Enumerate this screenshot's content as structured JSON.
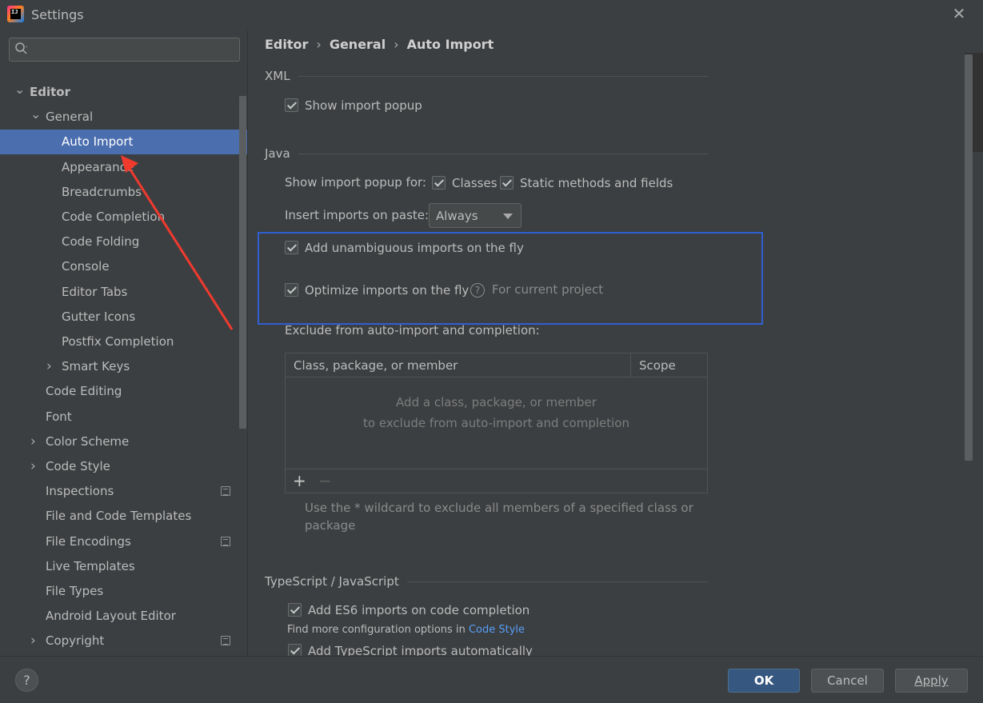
{
  "window": {
    "title": "Settings",
    "close": "✕"
  },
  "search": {
    "placeholder": ""
  },
  "breadcrumb": [
    "Editor",
    "General",
    "Auto Import"
  ],
  "sidebar": {
    "items": [
      {
        "label": "Editor",
        "level": 0,
        "chevron": "expanded"
      },
      {
        "label": "General",
        "level": 1,
        "chevron": "expanded"
      },
      {
        "label": "Auto Import",
        "level": 2,
        "selected": true
      },
      {
        "label": "Appearance",
        "level": 2
      },
      {
        "label": "Breadcrumbs",
        "level": 2
      },
      {
        "label": "Code Completion",
        "level": 2
      },
      {
        "label": "Code Folding",
        "level": 2
      },
      {
        "label": "Console",
        "level": 2
      },
      {
        "label": "Editor Tabs",
        "level": 2
      },
      {
        "label": "Gutter Icons",
        "level": 2
      },
      {
        "label": "Postfix Completion",
        "level": 2
      },
      {
        "label": "Smart Keys",
        "level": 2,
        "chevron": "collapsed"
      },
      {
        "label": "Code Editing",
        "level": 1
      },
      {
        "label": "Font",
        "level": 1
      },
      {
        "label": "Color Scheme",
        "level": 1,
        "chevron": "collapsed"
      },
      {
        "label": "Code Style",
        "level": 1,
        "chevron": "collapsed"
      },
      {
        "label": "Inspections",
        "level": 1,
        "project_icon": true
      },
      {
        "label": "File and Code Templates",
        "level": 1
      },
      {
        "label": "File Encodings",
        "level": 1,
        "project_icon": true
      },
      {
        "label": "Live Templates",
        "level": 1
      },
      {
        "label": "File Types",
        "level": 1
      },
      {
        "label": "Android Layout Editor",
        "level": 1
      },
      {
        "label": "Copyright",
        "level": 1,
        "chevron": "collapsed",
        "project_icon": true
      }
    ]
  },
  "xml": {
    "title": "XML",
    "show_import_popup": {
      "label": "Show import popup",
      "checked": true
    }
  },
  "java": {
    "title": "Java",
    "popup_for_label": "Show import popup for:",
    "classes": {
      "label": "Classes",
      "checked": true
    },
    "static": {
      "label": "Static methods and fields",
      "checked": true
    },
    "insert_label": "Insert imports on paste:",
    "insert_value": "Always",
    "unambiguous": {
      "label": "Add unambiguous imports on the fly",
      "checked": true
    },
    "optimize": {
      "label": "Optimize imports on the fly",
      "checked": true
    },
    "optimize_help": "?",
    "optimize_scope": "For current project",
    "exclude_label": "Exclude from auto-import and completion:",
    "table": {
      "columns": [
        "Class, package, or member",
        "Scope"
      ],
      "empty_line1": "Add a class, package, or member",
      "empty_line2": "to exclude from auto-import and completion",
      "add": "+",
      "remove": "−"
    },
    "hint": "Use the * wildcard to exclude all members of a specified class or package"
  },
  "ts": {
    "title": "TypeScript / JavaScript",
    "es6": {
      "label": "Add ES6 imports on code completion",
      "checked": true
    },
    "more_prefix": "Find more configuration options in",
    "more_link": "Code Style",
    "ts_auto": {
      "label": "Add TypeScript imports automatically",
      "checked": true
    }
  },
  "footer": {
    "help": "?",
    "ok": "OK",
    "cancel": "Cancel",
    "apply": "Apply"
  },
  "colors": {
    "selection": "#4b6eaf",
    "annotation_arrow": "#f03a2e",
    "annotation_box": "#2f5fd3",
    "link": "#589df6"
  }
}
